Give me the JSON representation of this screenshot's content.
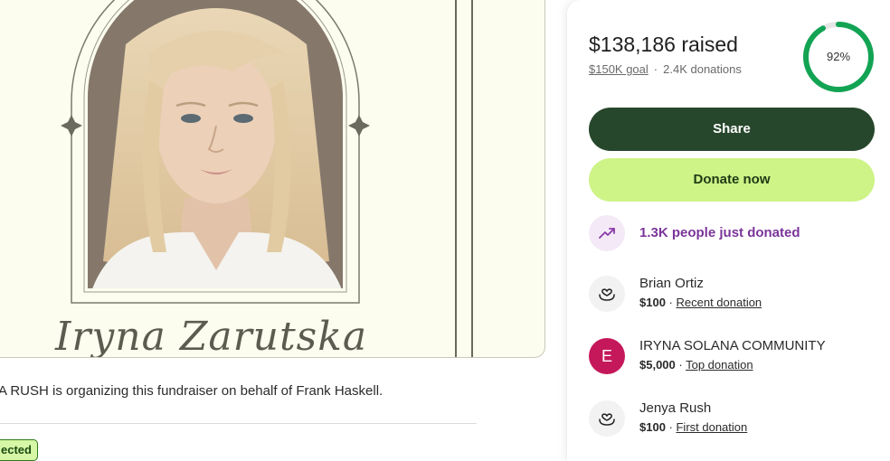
{
  "hero": {
    "name_script": "Iryna Zarutska"
  },
  "organizer": {
    "text": "A RUSH is organizing this fundraiser on behalf of Frank Haskell."
  },
  "badge": {
    "label": "ected"
  },
  "summary": {
    "raised": "$138,186 raised",
    "goal": "$150K goal",
    "separator": "·",
    "donations": "2.4K donations",
    "progress_label": "92%",
    "progress_fraction": 0.92
  },
  "buttons": {
    "share": "Share",
    "donate": "Donate now"
  },
  "activity": {
    "trend_text": "1.3K people just donated"
  },
  "donors": [
    {
      "name": "Brian Ortiz",
      "amount": "$100",
      "sep": " · ",
      "tag": "Recent donation",
      "avatar": "hand-heart-icon"
    },
    {
      "name": "IRYNA SOLANA COMMUNITY",
      "amount": "$5,000",
      "sep": " · ",
      "tag": "Top donation",
      "avatar_letter": "E"
    },
    {
      "name": "Jenya Rush",
      "amount": "$100",
      "sep": " · ",
      "tag": "First donation",
      "avatar": "hand-heart-icon"
    }
  ],
  "colors": {
    "share_bg": "#27472c",
    "donate_bg": "#cef386",
    "progress": "#12a454",
    "trend_text": "#7a3599",
    "letter_avatar": "#c4185a"
  }
}
